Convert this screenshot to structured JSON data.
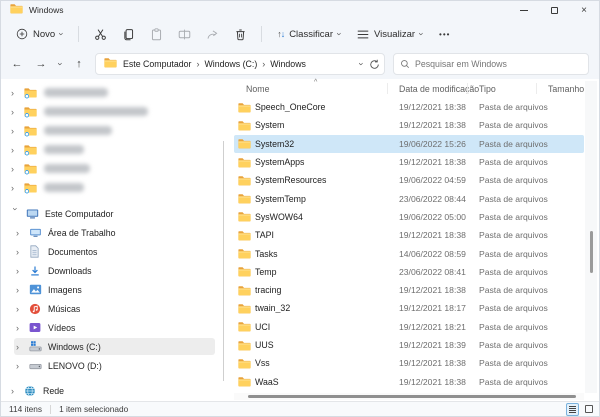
{
  "window": {
    "title": "Windows"
  },
  "icons": {
    "chevron": "›",
    "close": "×",
    "back": "←",
    "forward": "→",
    "up": "↑",
    "sort_up": "↑",
    "sort_down": "↓",
    "sort_asc": "^",
    "more": "•••"
  },
  "toolbar": {
    "novo_label": "Novo",
    "classificar_label": "Classificar",
    "visualizar_label": "Visualizar"
  },
  "address_bar": {
    "breadcrumb": [
      {
        "label": "Este Computador"
      },
      {
        "label": "Windows (C:)"
      },
      {
        "label": "Windows"
      }
    ],
    "search_placeholder": "Pesquisar em Windows"
  },
  "sidebar": {
    "blurred_items": [
      {
        "blur_width": 64
      },
      {
        "blur_width": 104
      },
      {
        "blur_width": 68
      },
      {
        "blur_width": 40
      },
      {
        "blur_width": 46
      },
      {
        "blur_width": 40
      }
    ],
    "items": [
      {
        "label": "Este Computador",
        "icon": "computer",
        "expanded": true,
        "indent": 0
      },
      {
        "label": "Área de Trabalho",
        "icon": "desktop",
        "indent": 1
      },
      {
        "label": "Documentos",
        "icon": "documents",
        "indent": 1
      },
      {
        "label": "Downloads",
        "icon": "downloads",
        "indent": 1
      },
      {
        "label": "Imagens",
        "icon": "pictures",
        "indent": 1
      },
      {
        "label": "Músicas",
        "icon": "music",
        "indent": 1
      },
      {
        "label": "Vídeos",
        "icon": "videos",
        "indent": 1
      },
      {
        "label": "Windows (C:)",
        "icon": "drive-windows",
        "selected": true,
        "indent": 1
      },
      {
        "label": "LENOVO (D:)",
        "icon": "drive",
        "indent": 1
      },
      {
        "label": "Rede",
        "icon": "network",
        "indent": 0,
        "gap_before": true
      }
    ]
  },
  "file_list": {
    "columns": [
      "Nome",
      "Data de modificação",
      "Tipo",
      "Tamanho"
    ],
    "rows": [
      {
        "name": "Speech_OneCore",
        "modified": "19/12/2021 18:38",
        "type": "Pasta de arquivos",
        "size": ""
      },
      {
        "name": "System",
        "modified": "19/12/2021 18:38",
        "type": "Pasta de arquivos",
        "size": ""
      },
      {
        "name": "System32",
        "modified": "19/06/2022 15:26",
        "type": "Pasta de arquivos",
        "size": "",
        "selected": true
      },
      {
        "name": "SystemApps",
        "modified": "19/12/2021 18:38",
        "type": "Pasta de arquivos",
        "size": ""
      },
      {
        "name": "SystemResources",
        "modified": "19/06/2022 04:59",
        "type": "Pasta de arquivos",
        "size": ""
      },
      {
        "name": "SystemTemp",
        "modified": "23/06/2022 08:44",
        "type": "Pasta de arquivos",
        "size": ""
      },
      {
        "name": "SysWOW64",
        "modified": "19/06/2022 05:00",
        "type": "Pasta de arquivos",
        "size": ""
      },
      {
        "name": "TAPI",
        "modified": "19/12/2021 18:38",
        "type": "Pasta de arquivos",
        "size": ""
      },
      {
        "name": "Tasks",
        "modified": "14/06/2022 08:59",
        "type": "Pasta de arquivos",
        "size": ""
      },
      {
        "name": "Temp",
        "modified": "23/06/2022 08:41",
        "type": "Pasta de arquivos",
        "size": ""
      },
      {
        "name": "tracing",
        "modified": "19/12/2021 18:38",
        "type": "Pasta de arquivos",
        "size": ""
      },
      {
        "name": "twain_32",
        "modified": "19/12/2021 18:17",
        "type": "Pasta de arquivos",
        "size": ""
      },
      {
        "name": "UCI",
        "modified": "19/12/2021 18:21",
        "type": "Pasta de arquivos",
        "size": ""
      },
      {
        "name": "UUS",
        "modified": "19/12/2021 18:39",
        "type": "Pasta de arquivos",
        "size": ""
      },
      {
        "name": "Vss",
        "modified": "19/12/2021 18:38",
        "type": "Pasta de arquivos",
        "size": ""
      },
      {
        "name": "WaaS",
        "modified": "19/12/2021 18:38",
        "type": "Pasta de arquivos",
        "size": ""
      }
    ]
  },
  "status_bar": {
    "items_count": "114 itens",
    "selection": "1 item selecionado"
  },
  "colors": {
    "selection_blue": "#cfe7f8",
    "chrome_bg": "#f3f6fa",
    "folder_front": "#ffd15e",
    "folder_back": "#e8a33c",
    "accent_blue": "#2b7cd3"
  }
}
